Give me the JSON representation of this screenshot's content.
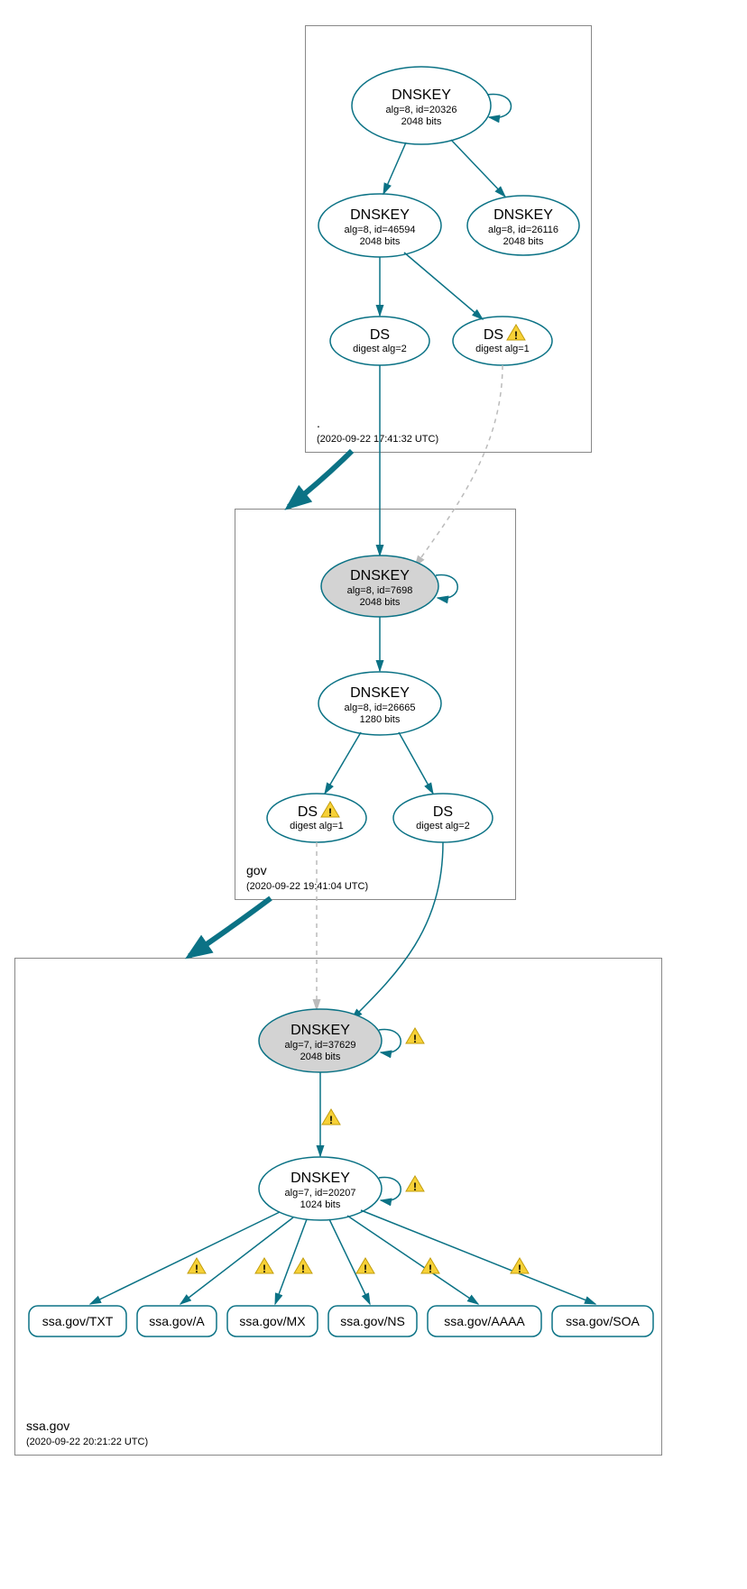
{
  "zones": {
    "root": {
      "label": ".",
      "timestamp": "(2020-09-22 17:41:32 UTC)"
    },
    "gov": {
      "label": "gov",
      "timestamp": "(2020-09-22 19:41:04 UTC)"
    },
    "ssagov": {
      "label": "ssa.gov",
      "timestamp": "(2020-09-22 20:21:22 UTC)"
    }
  },
  "nodes": {
    "root_key1": {
      "title": "DNSKEY",
      "l1": "alg=8, id=20326",
      "l2": "2048 bits"
    },
    "root_key2": {
      "title": "DNSKEY",
      "l1": "alg=8, id=46594",
      "l2": "2048 bits"
    },
    "root_key3": {
      "title": "DNSKEY",
      "l1": "alg=8, id=26116",
      "l2": "2048 bits"
    },
    "root_ds1": {
      "title": "DS",
      "l1": "digest alg=2"
    },
    "root_ds2": {
      "title": "DS",
      "l1": "digest alg=1"
    },
    "gov_key1": {
      "title": "DNSKEY",
      "l1": "alg=8, id=7698",
      "l2": "2048 bits"
    },
    "gov_key2": {
      "title": "DNSKEY",
      "l1": "alg=8, id=26665",
      "l2": "1280 bits"
    },
    "gov_ds1": {
      "title": "DS",
      "l1": "digest alg=1"
    },
    "gov_ds2": {
      "title": "DS",
      "l1": "digest alg=2"
    },
    "ssa_key1": {
      "title": "DNSKEY",
      "l1": "alg=7, id=37629",
      "l2": "2048 bits"
    },
    "ssa_key2": {
      "title": "DNSKEY",
      "l1": "alg=7, id=20207",
      "l2": "1024 bits"
    },
    "rr_txt": "ssa.gov/TXT",
    "rr_a": "ssa.gov/A",
    "rr_mx": "ssa.gov/MX",
    "rr_ns": "ssa.gov/NS",
    "rr_aaaa": "ssa.gov/AAAA",
    "rr_soa": "ssa.gov/SOA"
  }
}
